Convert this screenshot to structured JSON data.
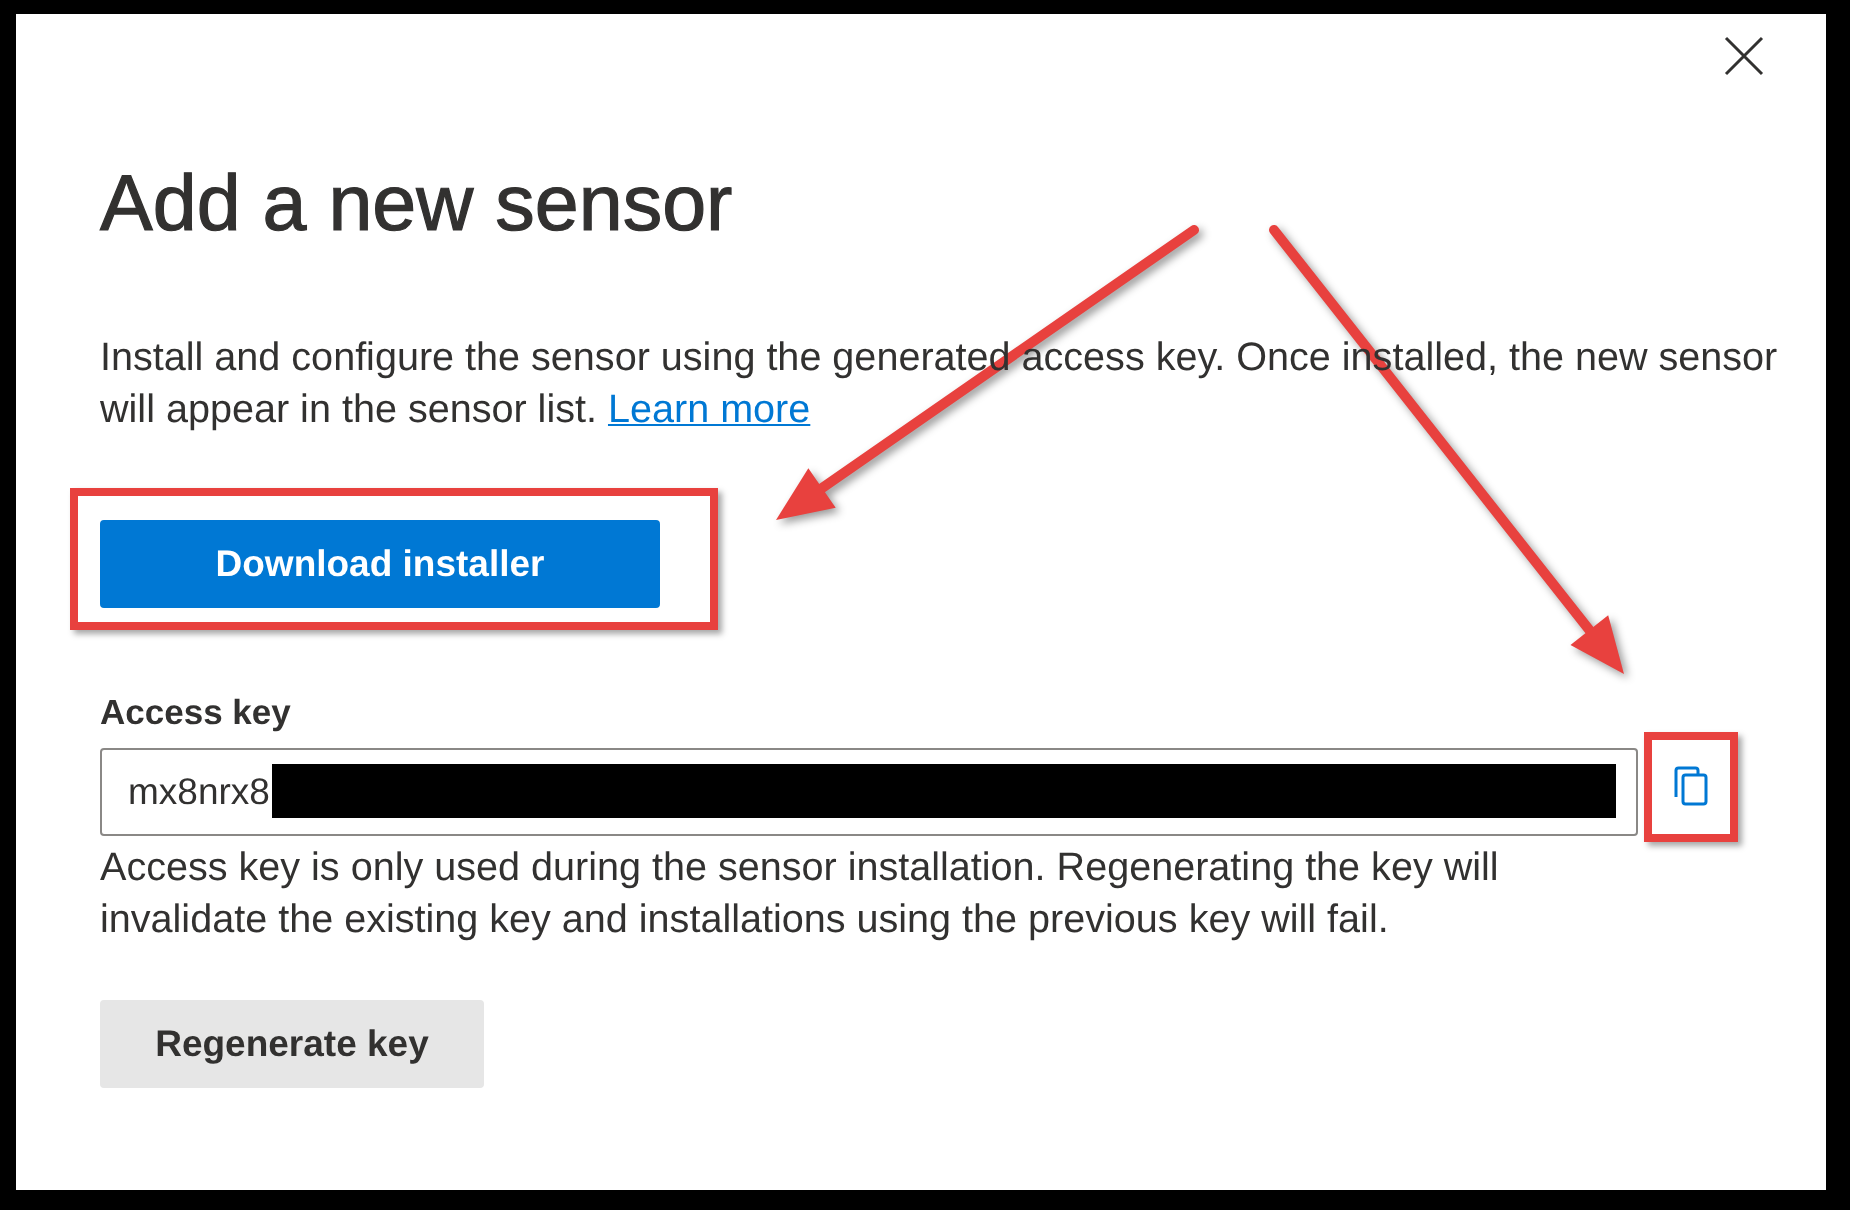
{
  "dialog": {
    "title": "Add a new sensor"
  },
  "description": {
    "text": "Install and configure the sensor using the generated access key. Once installed, the new sensor will appear in the sensor list.",
    "link": "Learn more"
  },
  "download_button": {
    "label": "Download installer",
    "highlighted": true
  },
  "access_key": {
    "label": "Access key",
    "value": "mx8nrx8",
    "redacted": true,
    "copy_button": {
      "highlighted": true
    },
    "help": "Access key is only used during the sensor installation. Regenerating the key will invalidate the existing key and installations using the previous key will fail."
  },
  "regenerate_button": {
    "label": "Regenerate key"
  }
}
